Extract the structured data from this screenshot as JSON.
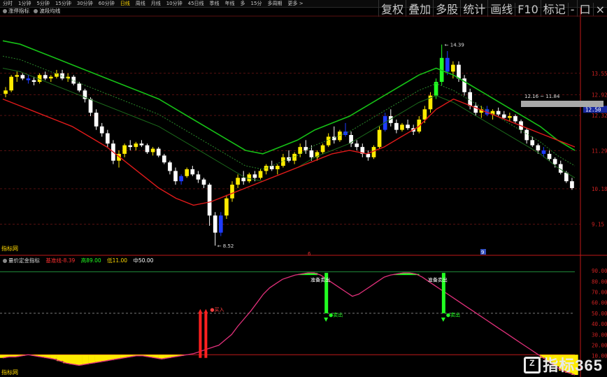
{
  "toolbar": {
    "items": [
      "分时",
      "1分钟",
      "5分钟",
      "15分钟",
      "30分钟",
      "60分钟",
      "日线",
      "周线",
      "月线",
      "10分钟",
      "45日线",
      "季线",
      "年线",
      "多",
      "15分",
      "多周期",
      "更多 >"
    ],
    "active_index": 6,
    "right_items": [
      "复权",
      "叠加",
      "多股",
      "统计",
      "画线",
      "F10",
      "标记",
      "-",
      "口",
      "×"
    ]
  },
  "main_indicator": {
    "label1": "涨停指标",
    "label2": "波段均线"
  },
  "sub_indicator": {
    "name": "量价定金指标",
    "l1_label": "基准线",
    "l1_value": "-8.39",
    "l2_label": "高",
    "l2_value": "89.00",
    "l3_label": "低",
    "l3_value": "11.00",
    "l4_label": "中",
    "l4_value": "50.00"
  },
  "annotations": {
    "high_price": "14.39",
    "low_price": "8.52",
    "range_label": "12.16 ~ 11.84",
    "current_price": "12.50",
    "buy_label": "买入",
    "prepare_sell": "准备卖出",
    "sell_label": "卖出",
    "left_label_main": "指标网",
    "left_label_sub": "指标网"
  },
  "colors": {
    "up": "#ffeb00",
    "down": "#ffffff",
    "blue": "#1e3cff",
    "green_bar": "#22ff22",
    "ma_green": "#16c016",
    "ma_red": "#e01a1a",
    "sub_line": "#e0307a",
    "grid": "#8a1a1a",
    "axis": "#c01818"
  },
  "watermark": {
    "text": "指标365"
  },
  "chart_data": [
    {
      "type": "candlestick",
      "title": "",
      "y_ticks": [
        "13.55",
        "12.92",
        "12.32",
        "11.29",
        "10.18",
        "9.15"
      ],
      "ylim": [
        8.3,
        15.2
      ],
      "x_markers": [
        "6",
        "9"
      ],
      "candles": [
        [
          12.95,
          13.15,
          12.85,
          13.05
        ],
        [
          13.05,
          13.5,
          13.0,
          13.45
        ],
        [
          13.45,
          13.6,
          13.3,
          13.5
        ],
        [
          13.5,
          13.55,
          13.35,
          13.4
        ],
        [
          13.4,
          13.5,
          13.25,
          13.35
        ],
        [
          13.35,
          13.45,
          13.2,
          13.3
        ],
        [
          13.3,
          13.55,
          13.25,
          13.5
        ],
        [
          13.5,
          13.6,
          13.35,
          13.4
        ],
        [
          13.4,
          13.5,
          13.3,
          13.45
        ],
        [
          13.45,
          13.65,
          13.4,
          13.55
        ],
        [
          13.55,
          13.65,
          13.35,
          13.4
        ],
        [
          13.4,
          13.55,
          13.3,
          13.45
        ],
        [
          13.45,
          13.5,
          13.2,
          13.25
        ],
        [
          13.25,
          13.3,
          13.0,
          13.05
        ],
        [
          13.05,
          13.1,
          12.7,
          12.8
        ],
        [
          12.8,
          12.85,
          12.3,
          12.4
        ],
        [
          12.4,
          12.5,
          11.9,
          12.0
        ],
        [
          12.0,
          12.1,
          11.7,
          11.8
        ],
        [
          11.8,
          11.9,
          11.4,
          11.5
        ],
        [
          11.5,
          11.6,
          10.9,
          11.0
        ],
        [
          11.0,
          11.3,
          10.8,
          11.2
        ],
        [
          11.2,
          11.5,
          11.1,
          11.45
        ],
        [
          11.45,
          11.6,
          11.3,
          11.4
        ],
        [
          11.4,
          11.55,
          11.3,
          11.5
        ],
        [
          11.5,
          11.6,
          11.4,
          11.45
        ],
        [
          11.45,
          11.5,
          11.2,
          11.25
        ],
        [
          11.25,
          11.4,
          11.15,
          11.35
        ],
        [
          11.35,
          11.4,
          11.1,
          11.15
        ],
        [
          11.15,
          11.2,
          10.9,
          10.95
        ],
        [
          10.95,
          11.0,
          10.6,
          10.7
        ],
        [
          10.7,
          10.8,
          10.3,
          10.4
        ],
        [
          10.4,
          10.6,
          10.3,
          10.55
        ],
        [
          10.55,
          10.8,
          10.5,
          10.75
        ],
        [
          10.75,
          10.85,
          10.55,
          10.6
        ],
        [
          10.6,
          10.7,
          10.35,
          10.45
        ],
        [
          10.45,
          10.5,
          10.2,
          10.3
        ],
        [
          10.3,
          10.35,
          9.1,
          9.4
        ],
        [
          9.4,
          9.5,
          8.52,
          8.9
        ],
        [
          8.9,
          9.5,
          8.8,
          9.4
        ],
        [
          9.4,
          10.0,
          9.3,
          9.9
        ],
        [
          9.9,
          10.4,
          9.8,
          10.3
        ],
        [
          10.3,
          10.6,
          10.2,
          10.5
        ],
        [
          10.5,
          10.7,
          10.3,
          10.4
        ],
        [
          10.4,
          10.65,
          10.35,
          10.6
        ],
        [
          10.6,
          10.7,
          10.4,
          10.5
        ],
        [
          10.5,
          10.75,
          10.45,
          10.7
        ],
        [
          10.7,
          10.9,
          10.6,
          10.85
        ],
        [
          10.85,
          11.0,
          10.7,
          10.75
        ],
        [
          10.75,
          10.9,
          10.6,
          10.85
        ],
        [
          10.85,
          11.2,
          10.8,
          11.1
        ],
        [
          11.1,
          11.3,
          10.95,
          11.0
        ],
        [
          11.0,
          11.25,
          10.9,
          11.2
        ],
        [
          11.2,
          11.5,
          11.1,
          11.4
        ],
        [
          11.4,
          11.6,
          11.2,
          11.3
        ],
        [
          11.3,
          11.45,
          11.0,
          11.1
        ],
        [
          11.1,
          11.3,
          11.0,
          11.25
        ],
        [
          11.25,
          11.5,
          11.2,
          11.45
        ],
        [
          11.45,
          11.8,
          11.4,
          11.7
        ],
        [
          11.7,
          12.0,
          11.5,
          11.6
        ],
        [
          11.6,
          11.9,
          11.55,
          11.85
        ],
        [
          11.85,
          12.1,
          11.7,
          11.75
        ],
        [
          11.75,
          11.85,
          11.4,
          11.5
        ],
        [
          11.5,
          11.6,
          11.3,
          11.4
        ],
        [
          11.4,
          11.5,
          11.1,
          11.2
        ],
        [
          11.2,
          11.3,
          11.0,
          11.1
        ],
        [
          11.1,
          11.45,
          11.05,
          11.4
        ],
        [
          11.4,
          12.0,
          11.35,
          11.9
        ],
        [
          11.9,
          12.4,
          11.85,
          12.3
        ],
        [
          12.3,
          12.5,
          12.0,
          12.1
        ],
        [
          12.1,
          12.2,
          11.8,
          11.9
        ],
        [
          11.9,
          12.1,
          11.85,
          12.05
        ],
        [
          12.05,
          12.2,
          11.9,
          11.95
        ],
        [
          11.95,
          12.05,
          11.75,
          11.85
        ],
        [
          11.85,
          12.3,
          11.8,
          12.2
        ],
        [
          12.2,
          12.6,
          12.1,
          12.5
        ],
        [
          12.5,
          13.0,
          12.4,
          12.9
        ],
        [
          12.9,
          13.4,
          12.8,
          13.3
        ],
        [
          13.3,
          14.39,
          13.2,
          14.0
        ],
        [
          14.0,
          14.2,
          13.5,
          13.6
        ],
        [
          13.6,
          13.9,
          13.4,
          13.8
        ],
        [
          13.8,
          13.9,
          13.3,
          13.4
        ],
        [
          13.4,
          13.5,
          12.9,
          13.0
        ],
        [
          13.0,
          13.1,
          12.5,
          12.6
        ],
        [
          12.6,
          12.7,
          12.3,
          12.4
        ],
        [
          12.4,
          12.6,
          12.25,
          12.5
        ],
        [
          12.5,
          12.6,
          12.3,
          12.35
        ],
        [
          12.35,
          12.5,
          12.2,
          12.45
        ],
        [
          12.45,
          12.55,
          12.3,
          12.35
        ],
        [
          12.35,
          12.45,
          12.2,
          12.25
        ],
        [
          12.25,
          12.4,
          12.15,
          12.3
        ],
        [
          12.3,
          12.35,
          12.1,
          12.15
        ],
        [
          12.15,
          12.2,
          11.8,
          11.9
        ],
        [
          11.9,
          11.95,
          11.5,
          11.6
        ],
        [
          11.6,
          11.7,
          11.4,
          11.45
        ],
        [
          11.45,
          11.5,
          11.2,
          11.3
        ],
        [
          11.3,
          11.4,
          11.1,
          11.2
        ],
        [
          11.2,
          11.3,
          11.0,
          11.05
        ],
        [
          11.05,
          11.1,
          10.8,
          10.9
        ],
        [
          10.9,
          11.0,
          10.6,
          10.65
        ],
        [
          10.65,
          10.7,
          10.35,
          10.4
        ],
        [
          10.4,
          10.5,
          10.15,
          10.2
        ]
      ],
      "blue_candle_indices": [
        4,
        31,
        38,
        60,
        67,
        78,
        85,
        95
      ],
      "ma_green_upper": [
        14.5,
        14.4,
        14.2,
        14.0,
        13.8,
        13.6,
        13.4,
        13.2,
        13.0,
        12.8,
        12.5,
        12.2,
        11.9,
        11.6,
        11.3,
        11.2,
        11.4,
        11.6,
        11.9,
        12.1,
        12.3,
        12.6,
        12.9,
        13.2,
        13.5,
        13.7,
        13.5,
        13.2,
        12.9,
        12.6,
        12.3,
        12.0,
        11.6,
        11.3
      ],
      "ma_red": [
        12.8,
        12.6,
        12.4,
        12.2,
        12.0,
        11.7,
        11.4,
        11.0,
        10.6,
        10.2,
        9.9,
        9.7,
        9.8,
        10.0,
        10.2,
        10.4,
        10.6,
        10.8,
        11.0,
        11.2,
        11.3,
        11.2,
        11.4,
        11.7,
        12.0,
        12.5,
        12.8,
        12.6,
        12.4,
        12.2,
        12.0,
        11.8,
        11.6,
        11.4
      ]
    },
    {
      "type": "line",
      "title": "",
      "y_ticks": [
        "90.00",
        "80.00",
        "70.00",
        "60.00",
        "50.00",
        "40.00",
        "30.00",
        "20.00",
        "10.00"
      ],
      "ylim": [
        -8,
        96
      ],
      "hlines": [
        89,
        50,
        11
      ],
      "series": [
        {
          "values": [
            8,
            9,
            9,
            10,
            11,
            10,
            9,
            8,
            7,
            5,
            3,
            2,
            1,
            2,
            3,
            4,
            5,
            6,
            7,
            8,
            9,
            10,
            10,
            9,
            8,
            7,
            8,
            9,
            10,
            11,
            12,
            14,
            16,
            18,
            20,
            25,
            30,
            38,
            45,
            52,
            60,
            68,
            74,
            78,
            82,
            84,
            86,
            87,
            88,
            88,
            86,
            82,
            78,
            74,
            70,
            66,
            68,
            72,
            76,
            80,
            84,
            86,
            87,
            88,
            88,
            87,
            84,
            80,
            76,
            72,
            68,
            64,
            60,
            56,
            52,
            48,
            44,
            40,
            36,
            32,
            28,
            24,
            20,
            16,
            12,
            8,
            4,
            0,
            -4,
            -6,
            -8
          ]
        }
      ],
      "buy_points": [
        0.355
      ],
      "sell_points": [
        0.565,
        0.77
      ]
    }
  ]
}
